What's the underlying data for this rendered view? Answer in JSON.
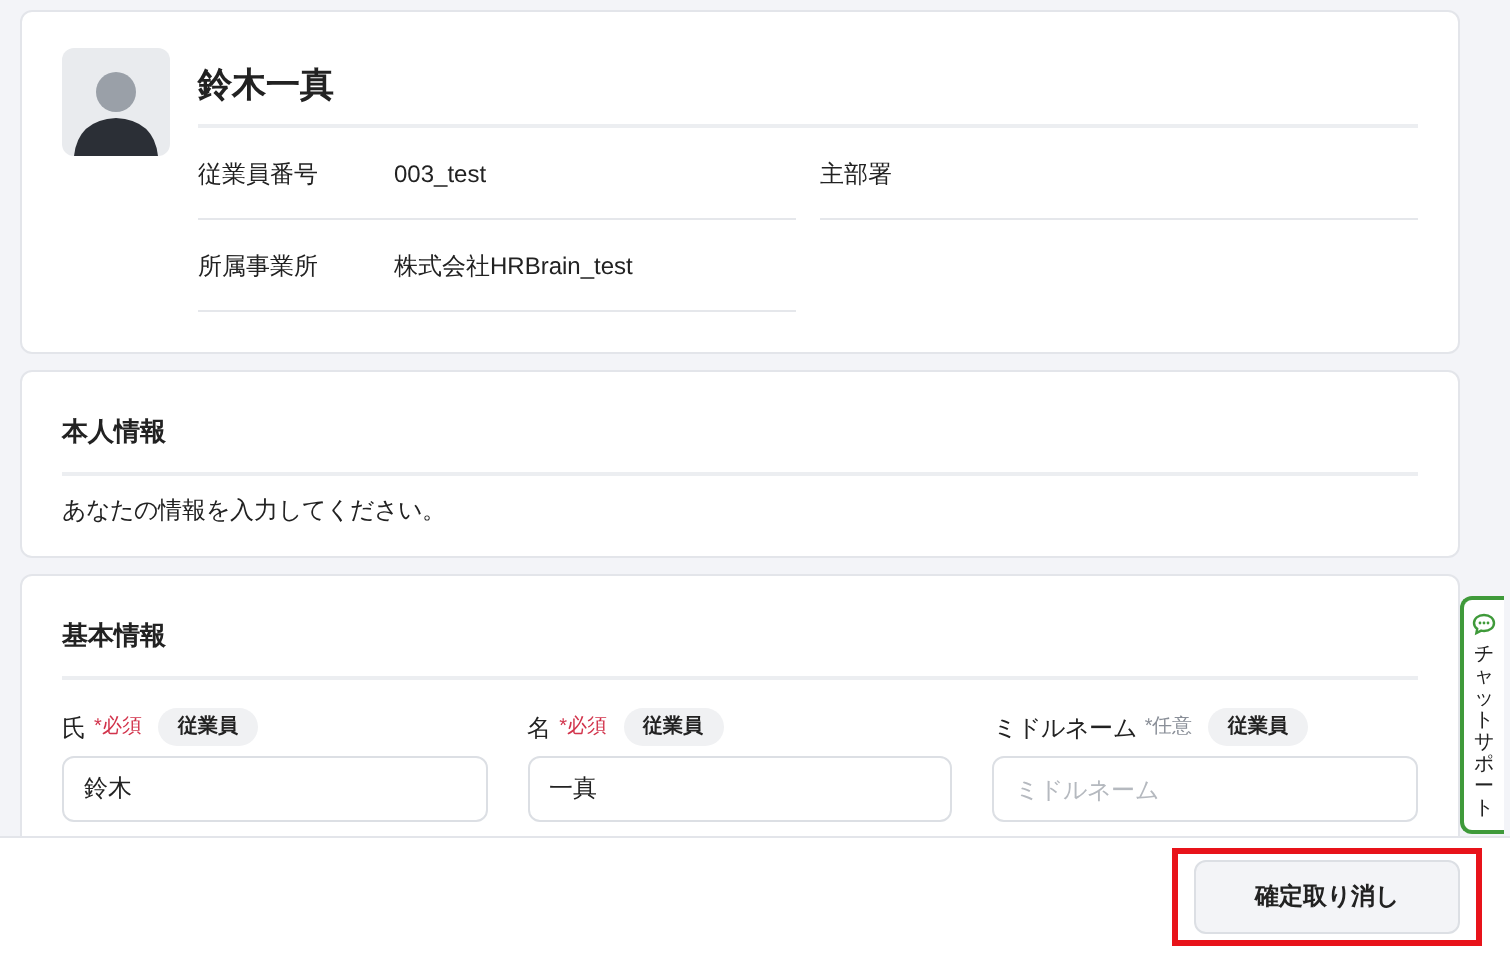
{
  "profile": {
    "name": "鈴木一真",
    "fields": [
      {
        "label": "従業員番号",
        "value": "003_test"
      },
      {
        "label": "主部署"
      },
      {
        "label": "所属事業所",
        "value": "株式会社HRBrain_test"
      }
    ]
  },
  "personal_section": {
    "title": "本人情報",
    "description": "あなたの情報を入力してください。"
  },
  "basic_section": {
    "title": "基本情報",
    "fields": [
      {
        "label": "氏",
        "requirement": "*必須",
        "required": true,
        "tag": "従業員",
        "value": "鈴木"
      },
      {
        "label": "名",
        "requirement": "*必須",
        "required": true,
        "tag": "従業員",
        "value": "一真"
      },
      {
        "label": "ミドルネーム",
        "requirement": "*任意",
        "required": false,
        "tag": "従業員",
        "placeholder": "ミドルネーム"
      }
    ]
  },
  "chat_support": {
    "label": "チャットサポート"
  },
  "footer": {
    "button": "確定取り消し"
  }
}
